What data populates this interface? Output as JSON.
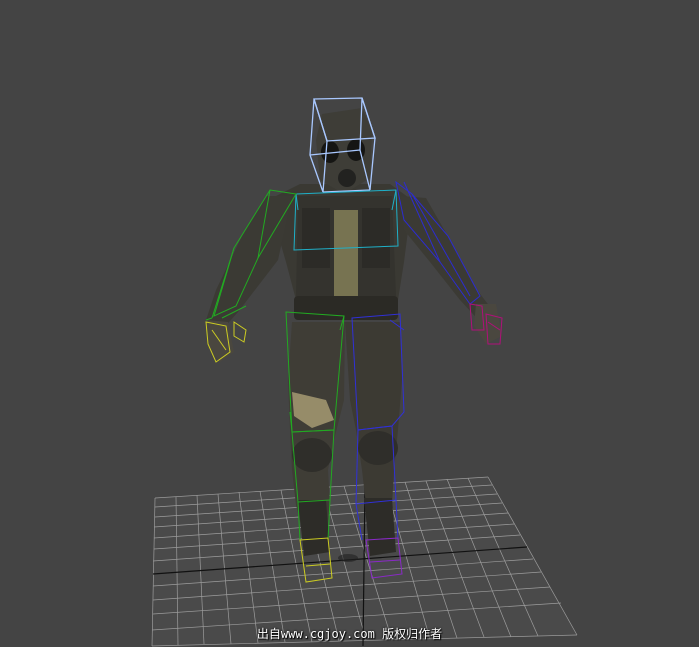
{
  "viewport": {
    "background": "#444444",
    "watermark": "出自www.cgjoy.com 版权归作者"
  },
  "colors": {
    "grid_minor": "#b8b8b8",
    "grid_major": "#111111",
    "head_bone": "#a9c8ff",
    "left_arm": "#22aa22",
    "left_hand": "#cccc22",
    "right_arm": "#2c2cd0",
    "right_hand": "#b0107a",
    "spine": "#1fb0c8",
    "left_leg": "#22aa22",
    "left_foot": "#cccc22",
    "right_leg": "#3030d8",
    "right_foot": "#8a2ac8"
  },
  "icons": [
    "character-model",
    "biped-rig",
    "ground-grid"
  ]
}
